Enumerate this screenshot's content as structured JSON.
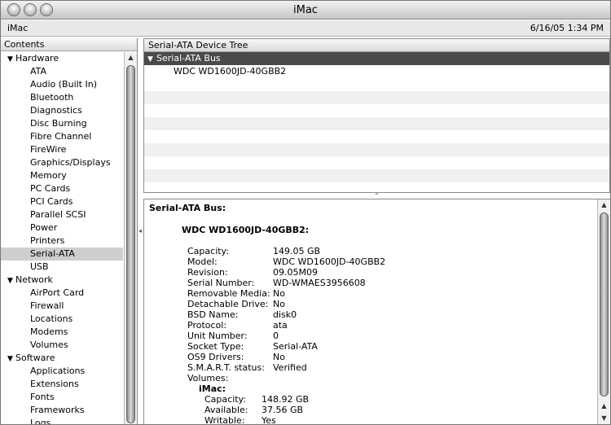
{
  "window": {
    "title": "iMac"
  },
  "infobar": {
    "computer_name": "iMac",
    "datetime": "6/16/05 1:34 PM"
  },
  "sidebar": {
    "header": "Contents",
    "categories": [
      {
        "label": "Hardware",
        "items": [
          "ATA",
          "Audio (Built In)",
          "Bluetooth",
          "Diagnostics",
          "Disc Burning",
          "Fibre Channel",
          "FireWire",
          "Graphics/Displays",
          "Memory",
          "PC Cards",
          "PCI Cards",
          "Parallel SCSI",
          "Power",
          "Printers",
          "Serial-ATA",
          "USB"
        ]
      },
      {
        "label": "Network",
        "items": [
          "AirPort Card",
          "Firewall",
          "Locations",
          "Modems",
          "Volumes"
        ]
      },
      {
        "label": "Software",
        "items": [
          "Applications",
          "Extensions",
          "Fonts",
          "Frameworks",
          "Logs"
        ]
      }
    ],
    "selected": "Serial-ATA"
  },
  "device_tree": {
    "header": "Serial-ATA Device Tree",
    "bus_label": "Serial-ATA Bus",
    "disk_label": "WDC WD1600JD-40GBB2"
  },
  "details": {
    "bus_heading": "Serial-ATA Bus:",
    "disk_heading": "WDC WD1600JD-40GBB2:",
    "properties": [
      {
        "key": "Capacity:",
        "value": "149.05 GB"
      },
      {
        "key": "Model:",
        "value": "WDC WD1600JD-40GBB2"
      },
      {
        "key": "Revision:",
        "value": "09.05M09"
      },
      {
        "key": "Serial Number:",
        "value": "WD-WMAES3956608"
      },
      {
        "key": "Removable Media:",
        "value": "No"
      },
      {
        "key": "Detachable Drive:",
        "value": "No"
      },
      {
        "key": "BSD Name:",
        "value": "disk0"
      },
      {
        "key": "Protocol:",
        "value": "ata"
      },
      {
        "key": "Unit Number:",
        "value": "0"
      },
      {
        "key": "Socket Type:",
        "value": "Serial-ATA"
      },
      {
        "key": "OS9 Drivers:",
        "value": "No"
      },
      {
        "key": "S.M.A.R.T. status:",
        "value": "Verified"
      },
      {
        "key": "Volumes:",
        "value": ""
      }
    ],
    "volume": {
      "name": "iMac:",
      "properties": [
        {
          "key": "Capacity:",
          "value": "148.92 GB"
        },
        {
          "key": "Available:",
          "value": "37.56 GB"
        },
        {
          "key": "Writable:",
          "value": "Yes"
        }
      ]
    }
  },
  "icons": {
    "expanded": "disclosure-triangle-down",
    "scroll_up": "arrow-up",
    "scroll_down": "arrow-down",
    "grip": "splitter-grip"
  }
}
